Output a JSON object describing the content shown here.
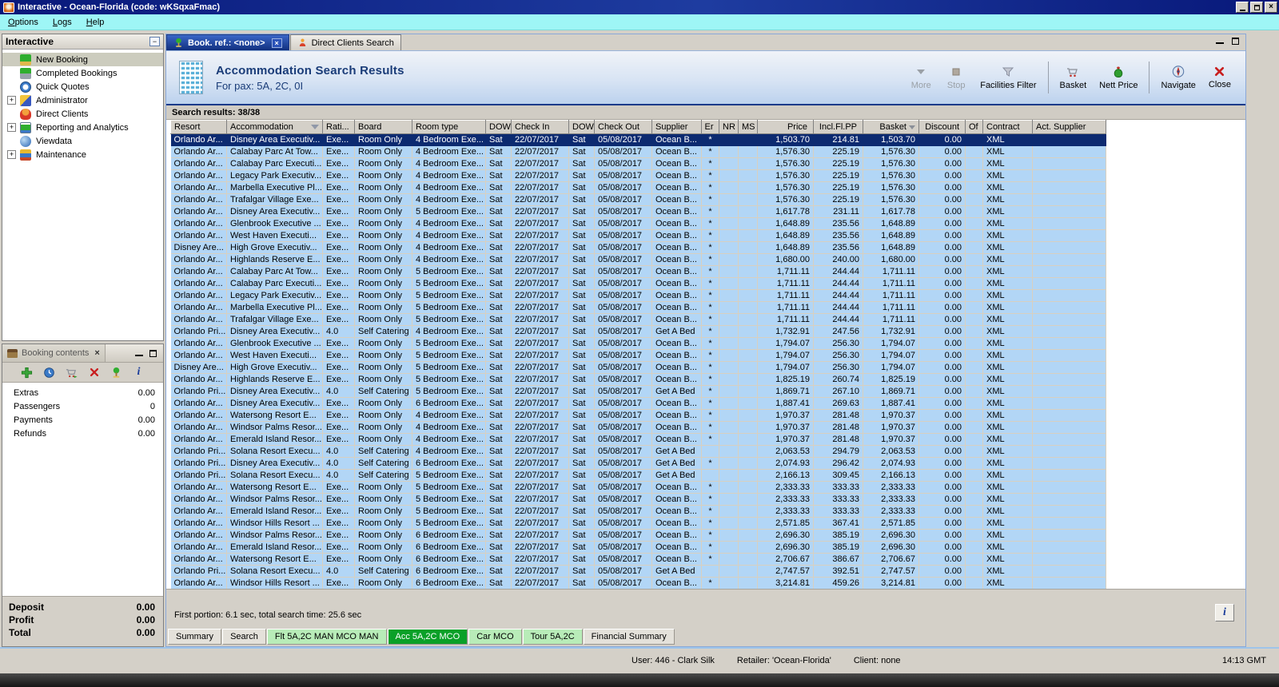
{
  "window": {
    "title": "Interactive - Ocean-Florida (code: wKSqxaFmac)"
  },
  "menu": [
    "Options",
    "Logs",
    "Help"
  ],
  "sidebar": {
    "title": "Interactive",
    "items": [
      {
        "label": "New Booking",
        "icon": "palm",
        "expander": "",
        "state": "selected"
      },
      {
        "label": "Completed Bookings",
        "icon": "money",
        "expander": "",
        "state": ""
      },
      {
        "label": "Quick Quotes",
        "icon": "clock",
        "expander": "",
        "state": ""
      },
      {
        "label": "Administrator",
        "icon": "runner",
        "expander": "+",
        "state": ""
      },
      {
        "label": "Direct Clients",
        "icon": "person",
        "expander": "",
        "state": ""
      },
      {
        "label": "Reporting and Analytics",
        "icon": "report",
        "expander": "+",
        "state": ""
      },
      {
        "label": "Viewdata",
        "icon": "globe",
        "expander": "",
        "state": ""
      },
      {
        "label": "Maintenance",
        "icon": "books",
        "expander": "+",
        "state": ""
      }
    ]
  },
  "booking_contents": {
    "title": "Booking contents",
    "toolbar_icons": [
      "add",
      "quick-quote",
      "move-to-basket",
      "delete",
      "new-booking",
      "info"
    ],
    "items": [
      {
        "label": "Extras",
        "value": "0.00"
      },
      {
        "label": "Passengers",
        "value": "0"
      },
      {
        "label": "Payments",
        "value": "0.00"
      },
      {
        "label": "Refunds",
        "value": "0.00"
      }
    ],
    "summary": [
      {
        "label": "Deposit",
        "value": "0.00"
      },
      {
        "label": "Profit",
        "value": "0.00"
      },
      {
        "label": "Total",
        "value": "0.00"
      }
    ]
  },
  "tabs": [
    {
      "label": "Book. ref.: <none>",
      "active": true
    },
    {
      "label": "Direct Clients Search",
      "active": false
    }
  ],
  "header": {
    "title": "Accommodation Search Results",
    "subtitle": "For pax: 5A, 2C, 0I"
  },
  "toolbar": {
    "more": "More",
    "stop": "Stop",
    "facilities_filter": "Facilities Filter",
    "basket": "Basket",
    "nett_price": "Nett Price",
    "navigate": "Navigate",
    "close": "Close"
  },
  "results": {
    "label": "Search results: 38/38"
  },
  "table": {
    "selected_index": 0,
    "columns": [
      {
        "label": "Resort",
        "align": "left",
        "icon": ""
      },
      {
        "label": "Accommodation",
        "align": "left",
        "icon": "filter"
      },
      {
        "label": "Rati...",
        "align": "left",
        "icon": ""
      },
      {
        "label": "Board",
        "align": "left",
        "icon": ""
      },
      {
        "label": "Room type",
        "align": "left",
        "icon": ""
      },
      {
        "label": "DOW",
        "align": "left",
        "icon": ""
      },
      {
        "label": "Check In",
        "align": "left",
        "icon": ""
      },
      {
        "label": "DOW",
        "align": "left",
        "icon": ""
      },
      {
        "label": "Check Out",
        "align": "left",
        "icon": ""
      },
      {
        "label": "Supplier",
        "align": "left",
        "icon": ""
      },
      {
        "label": "Er",
        "align": "center",
        "icon": ""
      },
      {
        "label": "NR",
        "align": "left",
        "icon": ""
      },
      {
        "label": "MS",
        "align": "left",
        "icon": ""
      },
      {
        "label": "Price",
        "align": "right",
        "icon": ""
      },
      {
        "label": "Incl.Fl.PP",
        "align": "right",
        "icon": ""
      },
      {
        "label": "Basket",
        "align": "right",
        "icon": "sort"
      },
      {
        "label": "Discount",
        "align": "right",
        "icon": ""
      },
      {
        "label": "Of",
        "align": "left",
        "icon": ""
      },
      {
        "label": "Contract",
        "align": "left",
        "icon": ""
      },
      {
        "label": "Act. Supplier",
        "align": "left",
        "icon": ""
      }
    ],
    "rows": [
      [
        "Orlando Ar...",
        "Disney Area Executiv...",
        "Exe...",
        "Room Only",
        "4 Bedroom Exe...",
        "Sat",
        "22/07/2017",
        "Sat",
        "05/08/2017",
        "Ocean B...",
        "*",
        "",
        "",
        "1,503.70",
        "214.81",
        "1,503.70",
        "0.00",
        "",
        "XML",
        ""
      ],
      [
        "Orlando Ar...",
        "Calabay Parc At Tow...",
        "Exe...",
        "Room Only",
        "4 Bedroom Exe...",
        "Sat",
        "22/07/2017",
        "Sat",
        "05/08/2017",
        "Ocean B...",
        "*",
        "",
        "",
        "1,576.30",
        "225.19",
        "1,576.30",
        "0.00",
        "",
        "XML",
        ""
      ],
      [
        "Orlando Ar...",
        "Calabay Parc Executi...",
        "Exe...",
        "Room Only",
        "4 Bedroom Exe...",
        "Sat",
        "22/07/2017",
        "Sat",
        "05/08/2017",
        "Ocean B...",
        "*",
        "",
        "",
        "1,576.30",
        "225.19",
        "1,576.30",
        "0.00",
        "",
        "XML",
        ""
      ],
      [
        "Orlando Ar...",
        "Legacy Park Executiv...",
        "Exe...",
        "Room Only",
        "4 Bedroom Exe...",
        "Sat",
        "22/07/2017",
        "Sat",
        "05/08/2017",
        "Ocean B...",
        "*",
        "",
        "",
        "1,576.30",
        "225.19",
        "1,576.30",
        "0.00",
        "",
        "XML",
        ""
      ],
      [
        "Orlando Ar...",
        "Marbella Executive Pl...",
        "Exe...",
        "Room Only",
        "4 Bedroom Exe...",
        "Sat",
        "22/07/2017",
        "Sat",
        "05/08/2017",
        "Ocean B...",
        "*",
        "",
        "",
        "1,576.30",
        "225.19",
        "1,576.30",
        "0.00",
        "",
        "XML",
        ""
      ],
      [
        "Orlando Ar...",
        "Trafalgar Village Exe...",
        "Exe...",
        "Room Only",
        "4 Bedroom Exe...",
        "Sat",
        "22/07/2017",
        "Sat",
        "05/08/2017",
        "Ocean B...",
        "*",
        "",
        "",
        "1,576.30",
        "225.19",
        "1,576.30",
        "0.00",
        "",
        "XML",
        ""
      ],
      [
        "Orlando Ar...",
        "Disney Area Executiv...",
        "Exe...",
        "Room Only",
        "5 Bedroom Exe...",
        "Sat",
        "22/07/2017",
        "Sat",
        "05/08/2017",
        "Ocean B...",
        "*",
        "",
        "",
        "1,617.78",
        "231.11",
        "1,617.78",
        "0.00",
        "",
        "XML",
        ""
      ],
      [
        "Orlando Ar...",
        "Glenbrook Executive ...",
        "Exe...",
        "Room Only",
        "4 Bedroom Exe...",
        "Sat",
        "22/07/2017",
        "Sat",
        "05/08/2017",
        "Ocean B...",
        "*",
        "",
        "",
        "1,648.89",
        "235.56",
        "1,648.89",
        "0.00",
        "",
        "XML",
        ""
      ],
      [
        "Orlando Ar...",
        "West Haven Executi...",
        "Exe...",
        "Room Only",
        "4 Bedroom Exe...",
        "Sat",
        "22/07/2017",
        "Sat",
        "05/08/2017",
        "Ocean B...",
        "*",
        "",
        "",
        "1,648.89",
        "235.56",
        "1,648.89",
        "0.00",
        "",
        "XML",
        ""
      ],
      [
        "Disney Are...",
        "High Grove Executiv...",
        "Exe...",
        "Room Only",
        "4 Bedroom Exe...",
        "Sat",
        "22/07/2017",
        "Sat",
        "05/08/2017",
        "Ocean B...",
        "*",
        "",
        "",
        "1,648.89",
        "235.56",
        "1,648.89",
        "0.00",
        "",
        "XML",
        ""
      ],
      [
        "Orlando Ar...",
        "Highlands Reserve E...",
        "Exe...",
        "Room Only",
        "4 Bedroom Exe...",
        "Sat",
        "22/07/2017",
        "Sat",
        "05/08/2017",
        "Ocean B...",
        "*",
        "",
        "",
        "1,680.00",
        "240.00",
        "1,680.00",
        "0.00",
        "",
        "XML",
        ""
      ],
      [
        "Orlando Ar...",
        "Calabay Parc At Tow...",
        "Exe...",
        "Room Only",
        "5 Bedroom Exe...",
        "Sat",
        "22/07/2017",
        "Sat",
        "05/08/2017",
        "Ocean B...",
        "*",
        "",
        "",
        "1,711.11",
        "244.44",
        "1,711.11",
        "0.00",
        "",
        "XML",
        ""
      ],
      [
        "Orlando Ar...",
        "Calabay Parc Executi...",
        "Exe...",
        "Room Only",
        "5 Bedroom Exe...",
        "Sat",
        "22/07/2017",
        "Sat",
        "05/08/2017",
        "Ocean B...",
        "*",
        "",
        "",
        "1,711.11",
        "244.44",
        "1,711.11",
        "0.00",
        "",
        "XML",
        ""
      ],
      [
        "Orlando Ar...",
        "Legacy Park Executiv...",
        "Exe...",
        "Room Only",
        "5 Bedroom Exe...",
        "Sat",
        "22/07/2017",
        "Sat",
        "05/08/2017",
        "Ocean B...",
        "*",
        "",
        "",
        "1,711.11",
        "244.44",
        "1,711.11",
        "0.00",
        "",
        "XML",
        ""
      ],
      [
        "Orlando Ar...",
        "Marbella Executive Pl...",
        "Exe...",
        "Room Only",
        "5 Bedroom Exe...",
        "Sat",
        "22/07/2017",
        "Sat",
        "05/08/2017",
        "Ocean B...",
        "*",
        "",
        "",
        "1,711.11",
        "244.44",
        "1,711.11",
        "0.00",
        "",
        "XML",
        ""
      ],
      [
        "Orlando Ar...",
        "Trafalgar Village Exe...",
        "Exe...",
        "Room Only",
        "5 Bedroom Exe...",
        "Sat",
        "22/07/2017",
        "Sat",
        "05/08/2017",
        "Ocean B...",
        "*",
        "",
        "",
        "1,711.11",
        "244.44",
        "1,711.11",
        "0.00",
        "",
        "XML",
        ""
      ],
      [
        "Orlando Pri...",
        "Disney Area Executiv...",
        "4.0",
        "Self Catering",
        "4 Bedroom Exe...",
        "Sat",
        "22/07/2017",
        "Sat",
        "05/08/2017",
        "Get A Bed",
        "*",
        "",
        "",
        "1,732.91",
        "247.56",
        "1,732.91",
        "0.00",
        "",
        "XML",
        ""
      ],
      [
        "Orlando Ar...",
        "Glenbrook Executive ...",
        "Exe...",
        "Room Only",
        "5 Bedroom Exe...",
        "Sat",
        "22/07/2017",
        "Sat",
        "05/08/2017",
        "Ocean B...",
        "*",
        "",
        "",
        "1,794.07",
        "256.30",
        "1,794.07",
        "0.00",
        "",
        "XML",
        ""
      ],
      [
        "Orlando Ar...",
        "West Haven Executi...",
        "Exe...",
        "Room Only",
        "5 Bedroom Exe...",
        "Sat",
        "22/07/2017",
        "Sat",
        "05/08/2017",
        "Ocean B...",
        "*",
        "",
        "",
        "1,794.07",
        "256.30",
        "1,794.07",
        "0.00",
        "",
        "XML",
        ""
      ],
      [
        "Disney Are...",
        "High Grove Executiv...",
        "Exe...",
        "Room Only",
        "5 Bedroom Exe...",
        "Sat",
        "22/07/2017",
        "Sat",
        "05/08/2017",
        "Ocean B...",
        "*",
        "",
        "",
        "1,794.07",
        "256.30",
        "1,794.07",
        "0.00",
        "",
        "XML",
        ""
      ],
      [
        "Orlando Ar...",
        "Highlands Reserve E...",
        "Exe...",
        "Room Only",
        "5 Bedroom Exe...",
        "Sat",
        "22/07/2017",
        "Sat",
        "05/08/2017",
        "Ocean B...",
        "*",
        "",
        "",
        "1,825.19",
        "260.74",
        "1,825.19",
        "0.00",
        "",
        "XML",
        ""
      ],
      [
        "Orlando Pri...",
        "Disney Area Executiv...",
        "4.0",
        "Self Catering",
        "5 Bedroom Exe...",
        "Sat",
        "22/07/2017",
        "Sat",
        "05/08/2017",
        "Get A Bed",
        "*",
        "",
        "",
        "1,869.71",
        "267.10",
        "1,869.71",
        "0.00",
        "",
        "XML",
        ""
      ],
      [
        "Orlando Ar...",
        "Disney Area Executiv...",
        "Exe...",
        "Room Only",
        "6 Bedroom Exe...",
        "Sat",
        "22/07/2017",
        "Sat",
        "05/08/2017",
        "Ocean B...",
        "*",
        "",
        "",
        "1,887.41",
        "269.63",
        "1,887.41",
        "0.00",
        "",
        "XML",
        ""
      ],
      [
        "Orlando Ar...",
        "Watersong Resort E...",
        "Exe...",
        "Room Only",
        "4 Bedroom Exe...",
        "Sat",
        "22/07/2017",
        "Sat",
        "05/08/2017",
        "Ocean B...",
        "*",
        "",
        "",
        "1,970.37",
        "281.48",
        "1,970.37",
        "0.00",
        "",
        "XML",
        ""
      ],
      [
        "Orlando Ar...",
        "Windsor Palms Resor...",
        "Exe...",
        "Room Only",
        "4 Bedroom Exe...",
        "Sat",
        "22/07/2017",
        "Sat",
        "05/08/2017",
        "Ocean B...",
        "*",
        "",
        "",
        "1,970.37",
        "281.48",
        "1,970.37",
        "0.00",
        "",
        "XML",
        ""
      ],
      [
        "Orlando Ar...",
        "Emerald Island Resor...",
        "Exe...",
        "Room Only",
        "4 Bedroom Exe...",
        "Sat",
        "22/07/2017",
        "Sat",
        "05/08/2017",
        "Ocean B...",
        "*",
        "",
        "",
        "1,970.37",
        "281.48",
        "1,970.37",
        "0.00",
        "",
        "XML",
        ""
      ],
      [
        "Orlando Pri...",
        "Solana Resort Execu...",
        "4.0",
        "Self Catering",
        "4 Bedroom Exe...",
        "Sat",
        "22/07/2017",
        "Sat",
        "05/08/2017",
        "Get A Bed",
        "",
        "",
        "",
        "2,063.53",
        "294.79",
        "2,063.53",
        "0.00",
        "",
        "XML",
        ""
      ],
      [
        "Orlando Pri...",
        "Disney Area Executiv...",
        "4.0",
        "Self Catering",
        "6 Bedroom Exe...",
        "Sat",
        "22/07/2017",
        "Sat",
        "05/08/2017",
        "Get A Bed",
        "*",
        "",
        "",
        "2,074.93",
        "296.42",
        "2,074.93",
        "0.00",
        "",
        "XML",
        ""
      ],
      [
        "Orlando Pri...",
        "Solana Resort Execu...",
        "4.0",
        "Self Catering",
        "5 Bedroom Exe...",
        "Sat",
        "22/07/2017",
        "Sat",
        "05/08/2017",
        "Get A Bed",
        "",
        "",
        "",
        "2,166.13",
        "309.45",
        "2,166.13",
        "0.00",
        "",
        "XML",
        ""
      ],
      [
        "Orlando Ar...",
        "Watersong Resort E...",
        "Exe...",
        "Room Only",
        "5 Bedroom Exe...",
        "Sat",
        "22/07/2017",
        "Sat",
        "05/08/2017",
        "Ocean B...",
        "*",
        "",
        "",
        "2,333.33",
        "333.33",
        "2,333.33",
        "0.00",
        "",
        "XML",
        ""
      ],
      [
        "Orlando Ar...",
        "Windsor Palms Resor...",
        "Exe...",
        "Room Only",
        "5 Bedroom Exe...",
        "Sat",
        "22/07/2017",
        "Sat",
        "05/08/2017",
        "Ocean B...",
        "*",
        "",
        "",
        "2,333.33",
        "333.33",
        "2,333.33",
        "0.00",
        "",
        "XML",
        ""
      ],
      [
        "Orlando Ar...",
        "Emerald Island Resor...",
        "Exe...",
        "Room Only",
        "5 Bedroom Exe...",
        "Sat",
        "22/07/2017",
        "Sat",
        "05/08/2017",
        "Ocean B...",
        "*",
        "",
        "",
        "2,333.33",
        "333.33",
        "2,333.33",
        "0.00",
        "",
        "XML",
        ""
      ],
      [
        "Orlando Ar...",
        "Windsor Hills Resort ...",
        "Exe...",
        "Room Only",
        "5 Bedroom Exe...",
        "Sat",
        "22/07/2017",
        "Sat",
        "05/08/2017",
        "Ocean B...",
        "*",
        "",
        "",
        "2,571.85",
        "367.41",
        "2,571.85",
        "0.00",
        "",
        "XML",
        ""
      ],
      [
        "Orlando Ar...",
        "Windsor Palms Resor...",
        "Exe...",
        "Room Only",
        "6 Bedroom Exe...",
        "Sat",
        "22/07/2017",
        "Sat",
        "05/08/2017",
        "Ocean B...",
        "*",
        "",
        "",
        "2,696.30",
        "385.19",
        "2,696.30",
        "0.00",
        "",
        "XML",
        ""
      ],
      [
        "Orlando Ar...",
        "Emerald Island Resor...",
        "Exe...",
        "Room Only",
        "6 Bedroom Exe...",
        "Sat",
        "22/07/2017",
        "Sat",
        "05/08/2017",
        "Ocean B...",
        "*",
        "",
        "",
        "2,696.30",
        "385.19",
        "2,696.30",
        "0.00",
        "",
        "XML",
        ""
      ],
      [
        "Orlando Ar...",
        "Watersong Resort E...",
        "Exe...",
        "Room Only",
        "6 Bedroom Exe...",
        "Sat",
        "22/07/2017",
        "Sat",
        "05/08/2017",
        "Ocean B...",
        "*",
        "",
        "",
        "2,706.67",
        "386.67",
        "2,706.67",
        "0.00",
        "",
        "XML",
        ""
      ],
      [
        "Orlando Pri...",
        "Solana Resort Execu...",
        "4.0",
        "Self Catering",
        "6 Bedroom Exe...",
        "Sat",
        "22/07/2017",
        "Sat",
        "05/08/2017",
        "Get A Bed",
        "",
        "",
        "",
        "2,747.57",
        "392.51",
        "2,747.57",
        "0.00",
        "",
        "XML",
        ""
      ],
      [
        "Orlando Ar...",
        "Windsor Hills Resort ...",
        "Exe...",
        "Room Only",
        "6 Bedroom Exe...",
        "Sat",
        "22/07/2017",
        "Sat",
        "05/08/2017",
        "Ocean B...",
        "*",
        "",
        "",
        "3,214.81",
        "459.26",
        "3,214.81",
        "0.00",
        "",
        "XML",
        ""
      ]
    ]
  },
  "footer": {
    "timing": "First portion: 6.1 sec, total search time: 25.6 sec",
    "info": "i"
  },
  "bottom_tabs": [
    {
      "label": "Summary",
      "style": "plain"
    },
    {
      "label": "Search",
      "style": "plain"
    },
    {
      "label": "Flt 5A,2C MAN MCO MAN",
      "style": "green"
    },
    {
      "label": "Acc 5A,2C MCO",
      "style": "activegreen"
    },
    {
      "label": "Car MCO",
      "style": "green"
    },
    {
      "label": "Tour 5A,2C",
      "style": "green"
    },
    {
      "label": "Financial Summary",
      "style": "plain"
    }
  ],
  "status_bar": {
    "user": "User: 446 - Clark Silk",
    "retailer": "Retailer: 'Ocean-Florida'",
    "client": "Client: none",
    "time": "14:13 GMT"
  },
  "colors": {
    "accent_navy": "#0c2a70",
    "row_blue": "#b2d6f6",
    "menu_cyan": "#9ef6f6",
    "tab_green": "#0aa028"
  }
}
